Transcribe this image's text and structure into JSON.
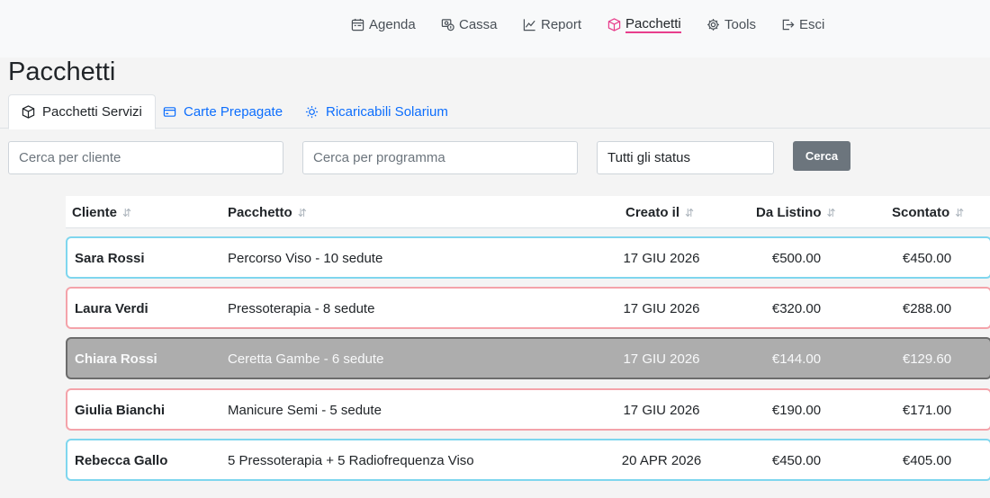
{
  "nav": [
    {
      "label": "Agenda",
      "icon": "calendar-icon",
      "active": false
    },
    {
      "label": "Cassa",
      "icon": "cash-icon",
      "active": false
    },
    {
      "label": "Report",
      "icon": "chart-line-icon",
      "active": false
    },
    {
      "label": "Pacchetti",
      "icon": "box-icon",
      "active": true
    },
    {
      "label": "Tools",
      "icon": "gear-icon",
      "active": false
    },
    {
      "label": "Esci",
      "icon": "logout-icon",
      "active": false
    }
  ],
  "page_title": "Pacchetti",
  "tabs": [
    {
      "label": "Pacchetti Servizi",
      "icon": "box-icon",
      "active": true
    },
    {
      "label": "Carte Prepagate",
      "icon": "credit-card-icon",
      "active": false
    },
    {
      "label": "Ricaricabili Solarium",
      "icon": "sun-icon",
      "active": false
    }
  ],
  "filters": {
    "client_placeholder": "Cerca per cliente",
    "program_placeholder": "Cerca per programma",
    "status_value": "Tutti gli status",
    "search_label": "Cerca"
  },
  "table": {
    "columns": [
      "Cliente",
      "Pacchetto",
      "Creato il",
      "Da Listino",
      "Scontato"
    ],
    "sort_icon": "⇵",
    "rows": [
      {
        "client": "Sara Rossi",
        "package": "Percorso Viso - 10 sedute",
        "created": "17 GIU 2026",
        "list_price": "€500.00",
        "discounted": "€450.00",
        "status_color": "#7fd6ee"
      },
      {
        "client": "Laura Verdi",
        "package": "Pressoterapia - 8 sedute",
        "created": "17 GIU 2026",
        "list_price": "€320.00",
        "discounted": "€288.00",
        "status_color": "#f4a3aa"
      },
      {
        "client": "Chiara Rossi",
        "package": "Ceretta Gambe - 6 sedute",
        "created": "17 GIU 2026",
        "list_price": "€144.00",
        "discounted": "€129.60",
        "status_color": "#6c6c6c"
      },
      {
        "client": "Giulia Bianchi",
        "package": "Manicure Semi - 5 sedute",
        "created": "17 GIU 2026",
        "list_price": "€190.00",
        "discounted": "€171.00",
        "status_color": "#f4a3aa"
      },
      {
        "client": "Rebecca Gallo",
        "package": "5 Pressoterapia + 5 Radiofrequenza Viso",
        "created": "20 APR 2026",
        "list_price": "€450.00",
        "discounted": "€405.00",
        "status_color": "#7fd6ee"
      }
    ]
  },
  "colors": {
    "accent": "#e83e8c",
    "link": "#0d6efd",
    "button": "#6c757d"
  }
}
